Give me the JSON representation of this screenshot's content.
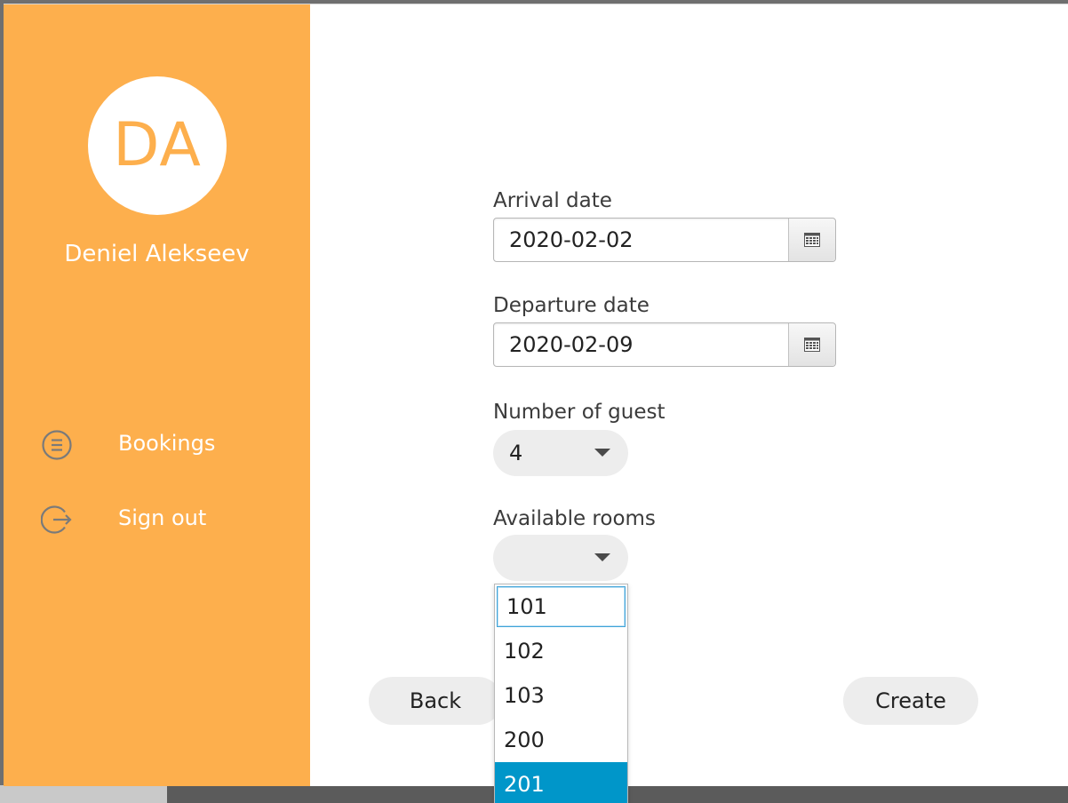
{
  "user": {
    "initials": "DA",
    "name": "Deniel Alekseev"
  },
  "nav": {
    "bookings_label": "Bookings",
    "signout_label": "Sign out"
  },
  "form": {
    "arrival_label": "Arrival date",
    "arrival_value": "2020-02-02",
    "departure_label": "Departure date",
    "departure_value": "2020-02-09",
    "guests_label": "Number of guest",
    "guests_value": "4",
    "rooms_label": "Available rooms",
    "rooms_value": ""
  },
  "rooms_dropdown": {
    "options": [
      "101",
      "102",
      "103",
      "200",
      "201"
    ],
    "focused": "101",
    "highlighted": "201"
  },
  "buttons": {
    "back_label": "Back",
    "create_label": "Create"
  },
  "colors": {
    "sidebar": "#fdaf4d",
    "highlight": "#0096c9",
    "focus_border": "#3fa3d8"
  },
  "icons": {
    "bookings": "list-circle-icon",
    "signout": "exit-arrow-icon",
    "calendar": "calendar-grid-icon",
    "dropdown": "chevron-down-icon"
  }
}
